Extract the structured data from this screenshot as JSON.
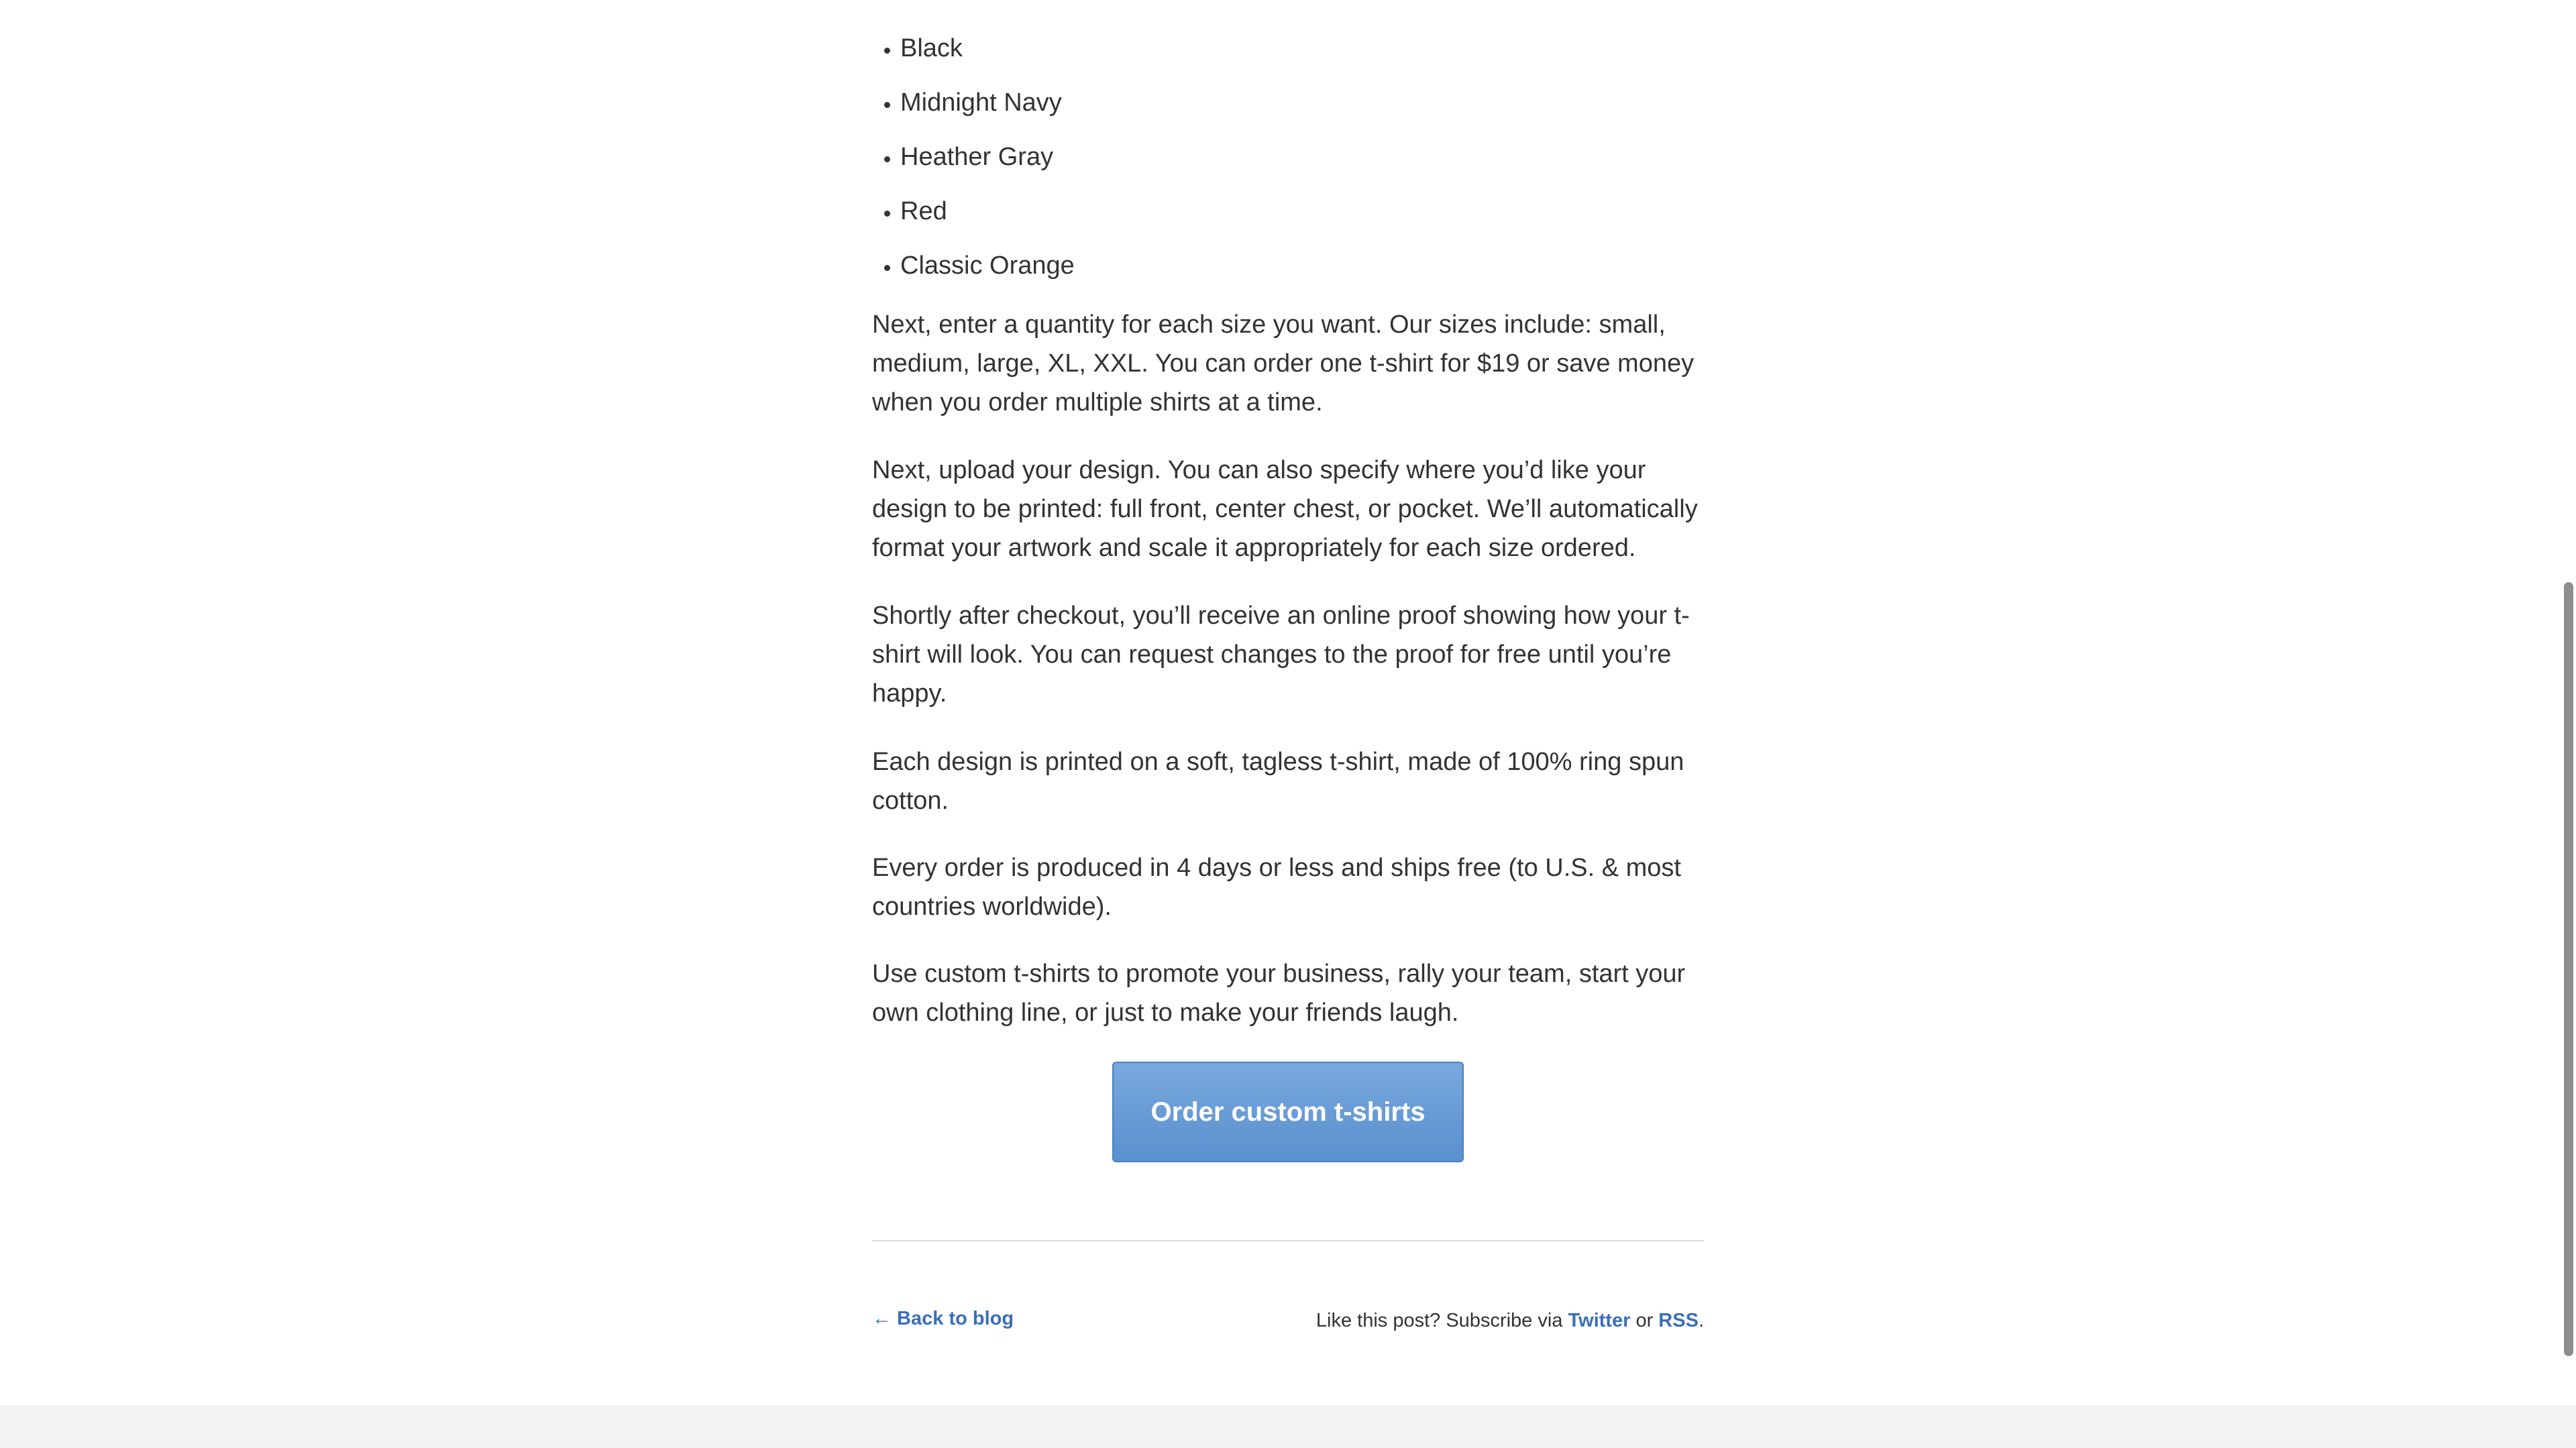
{
  "colors_list": [
    "Black",
    "Midnight Navy",
    "Heather Gray",
    "Red",
    "Classic Orange"
  ],
  "paragraphs": {
    "sizes": "Next, enter a quantity for each size you want. Our sizes include: small, medium, large, XL, XXL. You can order one t-shirt for $19 or save money when you order multiple shirts at a time.",
    "upload": "Next, upload your design. You can also specify where you’d like your design to be printed: full front, center chest, or pocket. We’ll automatically format your artwork and scale it appropriately for each size ordered.",
    "proof": "Shortly after checkout, you’ll receive an online proof showing how your t-shirt will look. You can request changes to the proof for free until you’re happy.",
    "material": "Each design is printed on a soft, tagless t-shirt, made of 100% ring spun cotton.",
    "shipping": "Every order is produced in 4 days or less and ships free (to U.S. & most countries worldwide).",
    "uses": "Use custom t-shirts to promote your business, rally your team, start your own clothing line, or just to make your friends laugh."
  },
  "cta": {
    "label": "Order custom t-shirts"
  },
  "footer": {
    "back_label": "← Back to blog",
    "subscribe_prefix": "Like this post? Subscribe via",
    "twitter_label": "Twitter",
    "or_text": "or",
    "rss_label": "RSS",
    "suffix": "."
  },
  "colors": {
    "link": "#3a6fb5",
    "button": "#6a9ed8",
    "text": "#333333"
  }
}
